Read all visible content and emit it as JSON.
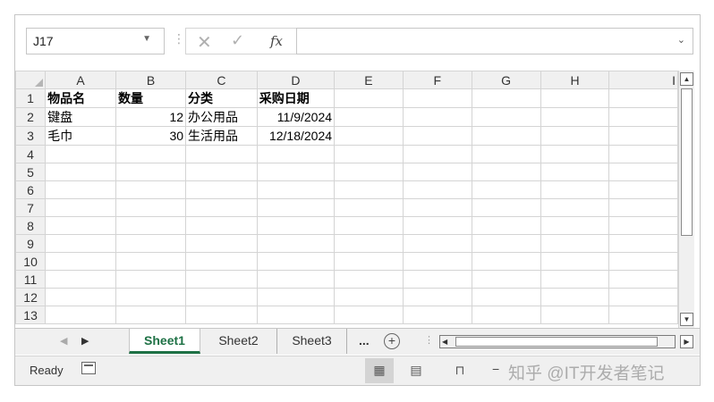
{
  "formula_bar": {
    "name_box": "J17",
    "cancel_symbol": "✕",
    "enter_symbol": "✓",
    "fx_label": "fx",
    "formula_value": ""
  },
  "columns": [
    "A",
    "B",
    "C",
    "D",
    "E",
    "F",
    "G",
    "H",
    "I"
  ],
  "rows": [
    {
      "num": "1",
      "cells": [
        "物品名",
        "数量",
        "分类",
        "采购日期",
        "",
        "",
        "",
        "",
        ""
      ]
    },
    {
      "num": "2",
      "cells": [
        "键盘",
        "12",
        "办公用品",
        "11/9/2024",
        "",
        "",
        "",
        "",
        ""
      ]
    },
    {
      "num": "3",
      "cells": [
        "毛巾",
        "30",
        "生活用品",
        "12/18/2024",
        "",
        "",
        "",
        "",
        ""
      ]
    },
    {
      "num": "4",
      "cells": [
        "",
        "",
        "",
        "",
        "",
        "",
        "",
        "",
        ""
      ]
    },
    {
      "num": "5",
      "cells": [
        "",
        "",
        "",
        "",
        "",
        "",
        "",
        "",
        ""
      ]
    },
    {
      "num": "6",
      "cells": [
        "",
        "",
        "",
        "",
        "",
        "",
        "",
        "",
        ""
      ]
    },
    {
      "num": "7",
      "cells": [
        "",
        "",
        "",
        "",
        "",
        "",
        "",
        "",
        ""
      ]
    },
    {
      "num": "8",
      "cells": [
        "",
        "",
        "",
        "",
        "",
        "",
        "",
        "",
        ""
      ]
    },
    {
      "num": "9",
      "cells": [
        "",
        "",
        "",
        "",
        "",
        "",
        "",
        "",
        ""
      ]
    },
    {
      "num": "10",
      "cells": [
        "",
        "",
        "",
        "",
        "",
        "",
        "",
        "",
        ""
      ]
    },
    {
      "num": "11",
      "cells": [
        "",
        "",
        "",
        "",
        "",
        "",
        "",
        "",
        ""
      ]
    },
    {
      "num": "12",
      "cells": [
        "",
        "",
        "",
        "",
        "",
        "",
        "",
        "",
        ""
      ]
    },
    {
      "num": "13",
      "cells": [
        "",
        "",
        "",
        "",
        "",
        "",
        "",
        "",
        ""
      ]
    }
  ],
  "sheet_tabs": {
    "tabs": [
      "Sheet1",
      "Sheet2",
      "Sheet3"
    ],
    "active": "Sheet1",
    "more": "...",
    "add": "+"
  },
  "status_bar": {
    "ready": "Ready",
    "zoom_minus": "−",
    "watermark": "知乎 @IT开发者笔记"
  },
  "colors": {
    "active_tab": "#1e7145",
    "header_bg": "#f0f0f0",
    "grid_line": "#d4d4d4"
  }
}
